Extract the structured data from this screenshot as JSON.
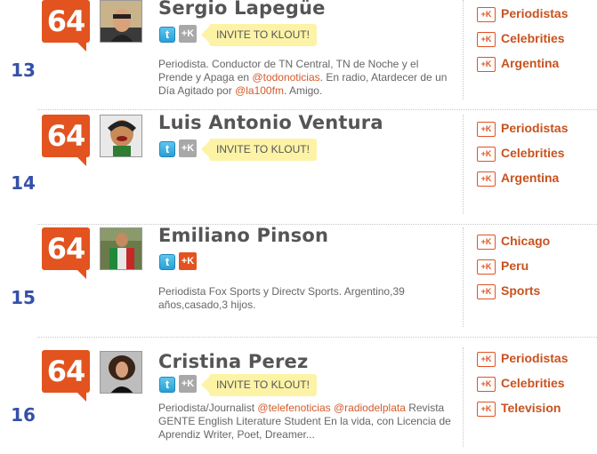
{
  "rows": [
    {
      "rank": "13",
      "score": "64",
      "name": "Sergio Lapegüe",
      "invite": "INVITE TO KLOUT!",
      "bio_text": "Periodista. Conductor de TN Central, TN de Noche y el Prende y Apaga en ",
      "bio_link1": "@todonoticias",
      "bio_text2": ". En radio, Atardecer de un Día Agitado por ",
      "bio_link2": "@la100fm",
      "bio_text3": ". Amigo.",
      "topics": [
        "Periodistas",
        "Celebrities",
        "Argentina"
      ]
    },
    {
      "rank": "14",
      "score": "64",
      "name": "Luis Antonio Ventura",
      "invite": "INVITE TO KLOUT!",
      "bio_text": "",
      "bio_link1": "",
      "bio_text2": "",
      "bio_link2": "",
      "bio_text3": "",
      "topics": [
        "Periodistas",
        "Celebrities",
        "Argentina"
      ]
    },
    {
      "rank": "15",
      "score": "64",
      "name": "Emiliano Pinson",
      "bio_text": "Periodista Fox Sports y Directv Sports. Argentino,39 años,casado,3 hijos.",
      "topics": [
        "Chicago",
        "Peru",
        "Sports"
      ]
    },
    {
      "rank": "16",
      "score": "64",
      "name": "Cristina Perez",
      "invite": "INVITE TO KLOUT!",
      "bio_text": "Periodista/Journalist ",
      "bio_link1": "@telefenoticias",
      "bio_text2": " ",
      "bio_link2": "@radiodelplata",
      "bio_text3": " Revista GENTE English Literature Student En la vida, con Licencia de Aprendiz Writer, Poet, Dreamer...",
      "topics": [
        "Periodistas",
        "Celebrities",
        "Television"
      ]
    }
  ],
  "icons": {
    "twitter": "twitter-icon",
    "klout": "klout-icon",
    "plusk": "+K"
  },
  "colors": {
    "score_bg": "#e2531f",
    "rank": "#3550a8",
    "topic": "#c8521e",
    "invite_bg": "#fdf3a6"
  }
}
